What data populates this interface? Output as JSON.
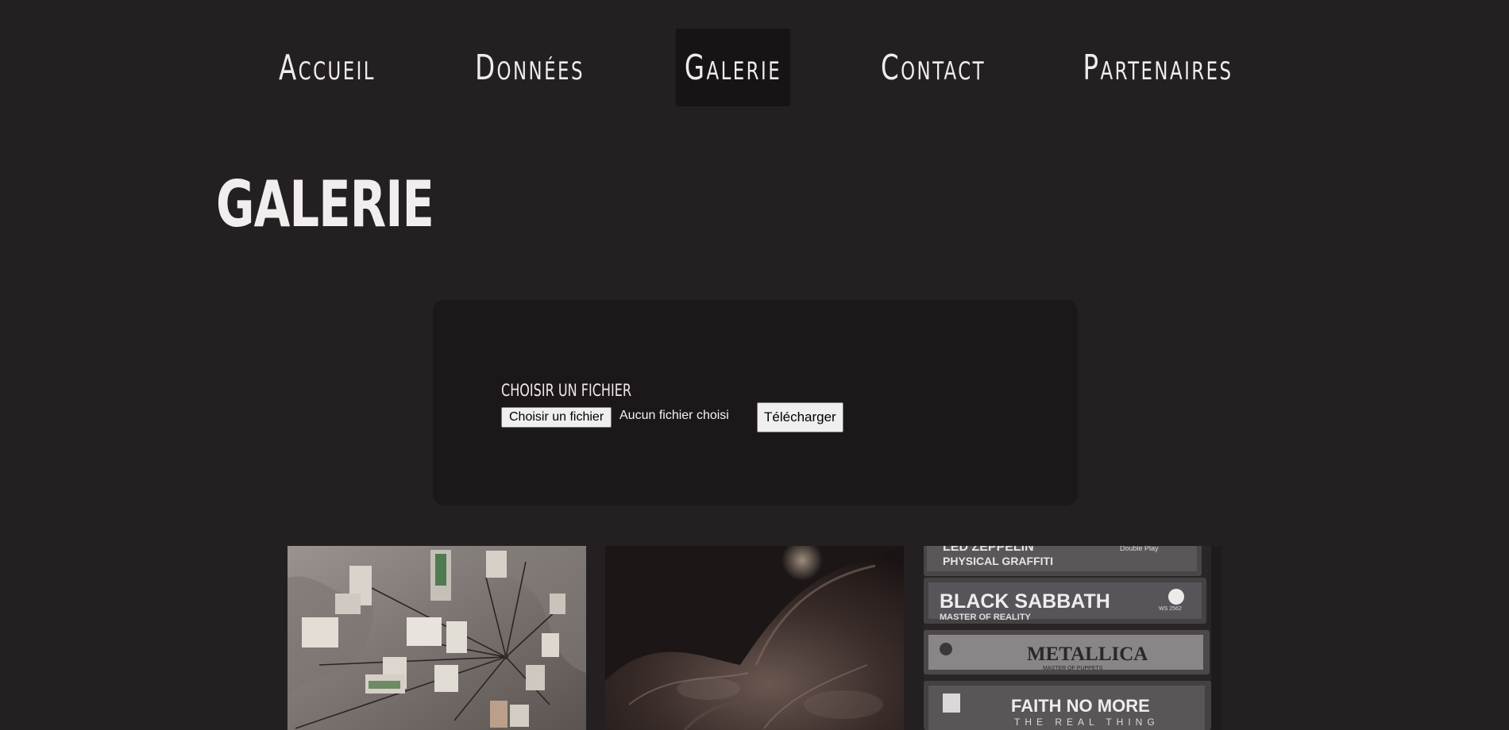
{
  "nav": {
    "items": [
      {
        "label": "Accueil"
      },
      {
        "label": "Données"
      },
      {
        "label": "Galerie",
        "active": true
      },
      {
        "label": "Contact"
      },
      {
        "label": "Partenaires"
      }
    ]
  },
  "page": {
    "title": "GALERIE"
  },
  "upload": {
    "label": "CHOISIR UN FICHIER",
    "file_button": "Choisir un fichier",
    "file_status": "Aucun fichier choisi",
    "submit_button": "Télécharger"
  },
  "gallery": {
    "images": [
      {
        "icon": "map-board-photo"
      },
      {
        "icon": "leather-jacket-photo"
      },
      {
        "icon": "cassette-tapes-photo",
        "tape_labels": [
          {
            "title": "LED ZEPPELIN",
            "subtitle": "PHYSICAL GRAFFITI",
            "side": "Double Play"
          },
          {
            "title": "BLACK SABBATH",
            "subtitle": "MASTER OF REALITY",
            "side": "WS 2562"
          },
          {
            "title": "METALLICA",
            "subtitle": "MASTER OF PUPPETS"
          },
          {
            "title": "FAITH NO MORE",
            "subtitle": "THE REAL THING"
          }
        ]
      }
    ]
  },
  "colors": {
    "background": "#242022",
    "nav_active": "#181415",
    "panel": "#1c1819",
    "text": "#efeaea"
  }
}
